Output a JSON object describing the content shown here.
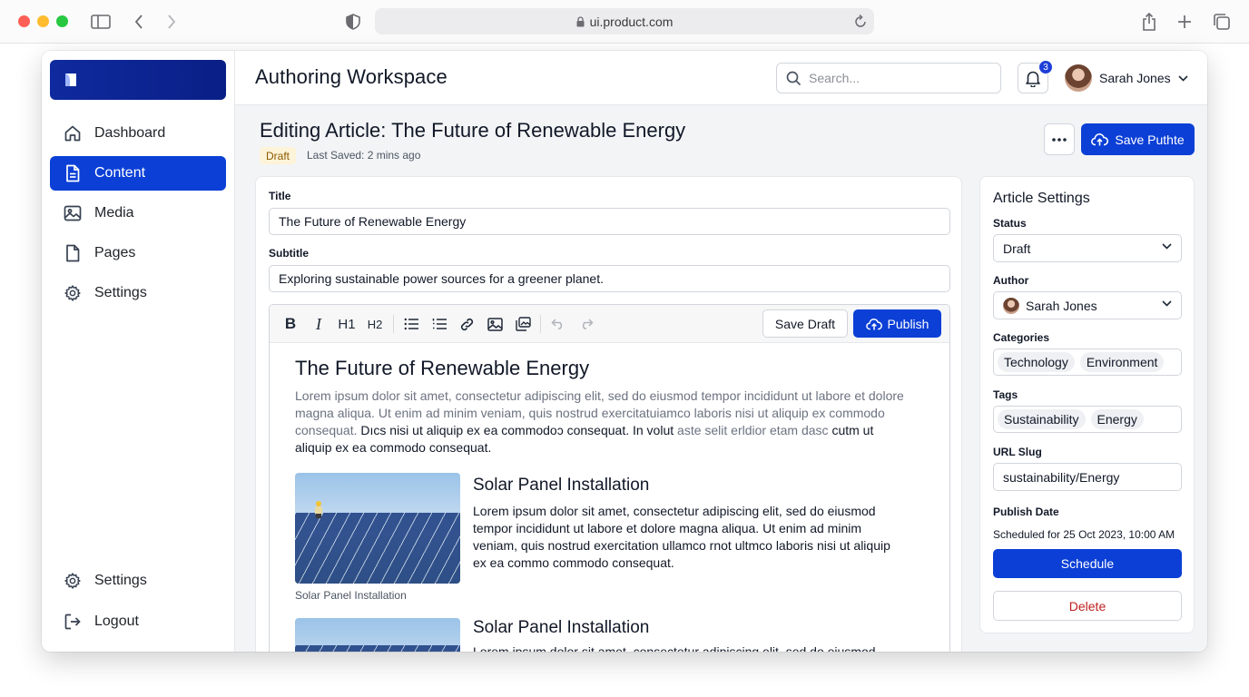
{
  "browser": {
    "url": "ui.product.com"
  },
  "sidebar": {
    "items": [
      {
        "label": "Dashboard"
      },
      {
        "label": "Content"
      },
      {
        "label": "Media"
      },
      {
        "label": "Pages"
      },
      {
        "label": "Settings"
      }
    ],
    "bottom": [
      {
        "label": "Settings"
      },
      {
        "label": "Logout"
      }
    ]
  },
  "header": {
    "title": "Authoring Workspace",
    "search_placeholder": "Search...",
    "notification_count": "3",
    "user_name": "Sarah Jones"
  },
  "page": {
    "title": "Editing Article: The Future of Renewable Energy",
    "status_badge": "Draft",
    "last_saved": "Last Saved: 2 mins ago",
    "save_publish_label": "Save Puthte"
  },
  "editor": {
    "title_label": "Title",
    "title_value": "The Future of Renewable Energy",
    "subtitle_label": "Subtitle",
    "subtitle_value": "Exploring sustainable power sources for a greener planet.",
    "toolbar": {
      "h1": "H1",
      "h2": "H2",
      "save_draft": "Save Draft",
      "publish": "Publish"
    },
    "content": {
      "heading": "The Future of Renewable Energy",
      "para_grey": "Lorem ipsum dolor sit amet, consectetur adipiscing elit, sed do eiusmod tempor incididunt ut labore et dolore magna aliqua. Ut enim ad minim veniam, quis nostrud exercitatuiamco laboris nisi ut aliquip ex commodo consequat.",
      "para_dark": "Dıcs nisi ut aliquip ex ea commodoɔ consequat. In volut",
      "para_grey2": "aste selit erldior etam dasc",
      "para_dark2": "cutm ut aliquip ex ea commodo consequat.",
      "sections": [
        {
          "title": "Solar Panel Installation",
          "text": "Lorem ipsum dolor sit amet, consectetur adipiscing elit, sed do eiusmod tempor incididunt ut labore et dolore magna aliqua. Ut enim ad minim veniam, quis nostrud exercitation ullamco rnot ultmco laboris nisi ut aliquip ex ea commo commodo consequat.",
          "caption": "Solar Panel Installation"
        },
        {
          "title": "Solar Panel Installation",
          "text": "Lorem ipsum dolor sit amet, consectetur adipiscing elit, sed do eiusmod"
        }
      ]
    }
  },
  "settings": {
    "title": "Article Settings",
    "status_label": "Status",
    "status_value": "Draft",
    "author_label": "Author",
    "author_value": "Sarah Jones",
    "categories_label": "Categories",
    "categories": [
      "Technology",
      "Environment"
    ],
    "tags_label": "Tags",
    "tags": [
      "Sustainability",
      "Energy"
    ],
    "slug_label": "URL Slug",
    "slug_value": "sustainability/Energy",
    "publish_date_label": "Publish Date",
    "publish_date_value": "Scheduled for 25 Oct 2023, 10:00 AM",
    "schedule_label": "Schedule",
    "delete_label": "Delete"
  },
  "colors": {
    "accent": "#0b3fd6",
    "danger": "#c21f1f",
    "draft_badge_bg": "#fdf3d8"
  }
}
